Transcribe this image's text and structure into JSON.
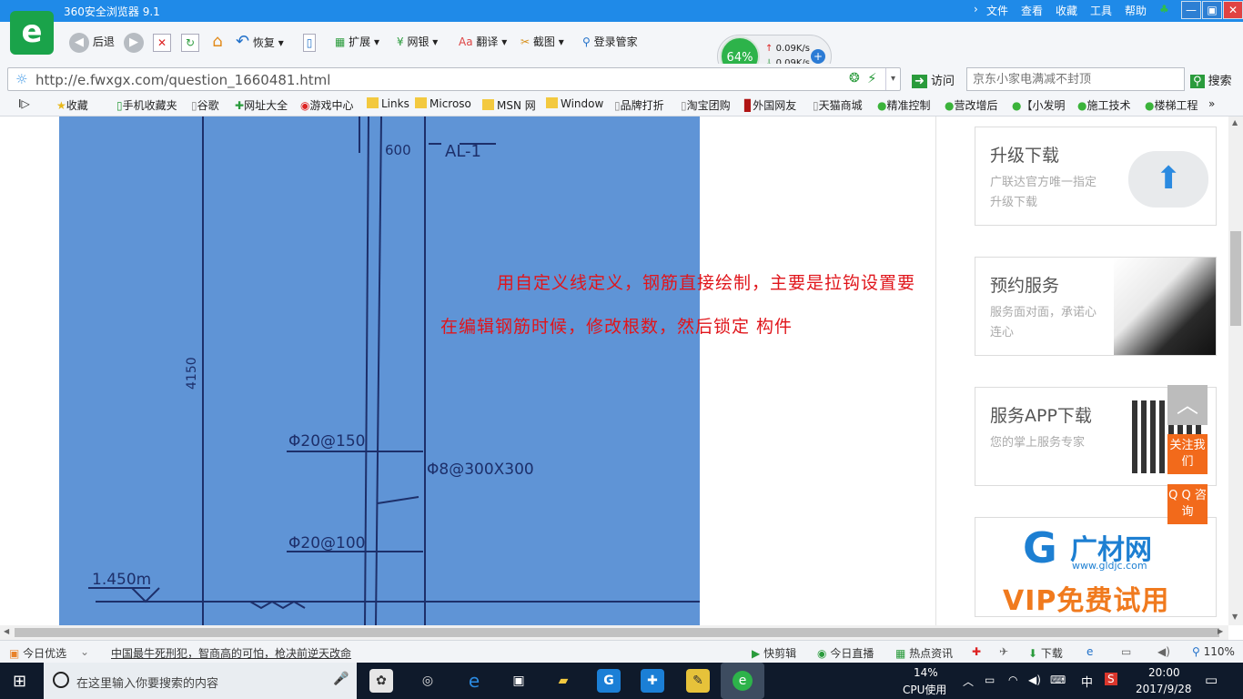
{
  "window": {
    "title": "360安全浏览器 9.1",
    "menu": [
      "文件",
      "查看",
      "收藏",
      "工具",
      "帮助"
    ],
    "controls": {
      "minimize": "—",
      "restore": "▣",
      "close": "✕"
    }
  },
  "logo": {
    "glyph": "e",
    "color": "#1aa34a"
  },
  "toolbar": {
    "back": "后退",
    "restore": "恢复",
    "extensions": "扩展",
    "netbank": "网银",
    "translate": "翻译",
    "screenshot": "截图",
    "login_manager": "登录管家",
    "speed": {
      "percent": "64%",
      "up": "0.09K/s",
      "down": "0.09K/s"
    }
  },
  "address": {
    "url": "http://e.fwxgx.com/question_1660481.html",
    "visit": "访问",
    "search_placeholder": "京东小家电满减不封顶",
    "search_button": "搜索"
  },
  "bookmarks": [
    "收藏",
    "手机收藏夹",
    "谷歌",
    "网址大全",
    "游戏中心",
    "Links",
    "Microso",
    "MSN 网",
    "Window",
    "品牌打折",
    "淘宝团购",
    "外国网友",
    "天猫商城",
    "精准控制",
    "营改增后",
    "【小发明",
    "施工技术",
    "楼梯工程"
  ],
  "drawing": {
    "labels": [
      "600",
      "AL-1",
      "4150",
      "Φ20@150",
      "Φ8@300X300",
      "Φ20@100",
      "1.450m"
    ]
  },
  "answer": {
    "line1": "用自定义线定义，钢筋直接绘制，主要是拉钩设置要",
    "line2": "在编辑钢筋时候，修改根数，然后锁定 构件"
  },
  "sidebar": {
    "upgrade": {
      "title": "升级下载",
      "desc": "广联达官方唯一指定升级下载"
    },
    "booking": {
      "title": "预约服务",
      "desc": "服务面对面，承诺心连心"
    },
    "app": {
      "title": "服务APP下载",
      "desc": "您的掌上服务专家"
    },
    "ad": {
      "brand": "广材网",
      "site": "www.gldjc.com",
      "slogan": "VIP免费试用"
    }
  },
  "float_buttons": {
    "top": "︿",
    "follow": "关注我们",
    "qq": "Q Q 咨询"
  },
  "statusbar": {
    "today_pick": "今日优选",
    "news": "中国最牛死刑犯，智商高的可怕，枪决前逆天改命",
    "quick_clip": "快剪辑",
    "live": "今日直播",
    "hot_news": "热点资讯",
    "download": "下载",
    "zoom": "110%"
  },
  "taskbar": {
    "search_placeholder": "在这里输入你要搜索的内容",
    "cpu_percent": "14%",
    "cpu_label": "CPU使用",
    "ime": "中",
    "time": "20:00",
    "date": "2017/9/28"
  }
}
